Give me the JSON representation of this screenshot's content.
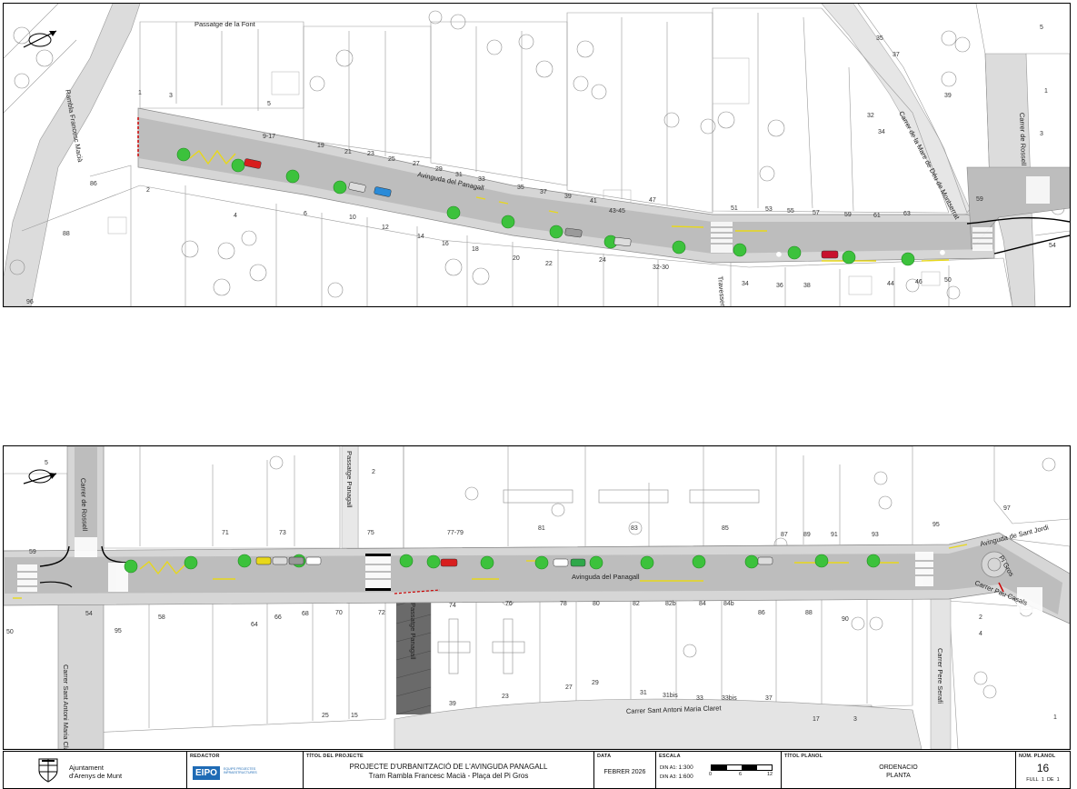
{
  "top_plan": {
    "streets": {
      "passatge_font": "Passatge de la Font",
      "rambla": "Rambla Francesc Macià",
      "avinguda": "Avinguda del Panagall",
      "montserrat": "Carrer de la Mare de Déu de Montserrat",
      "rossell": "Carrer de Rossell",
      "travessera": "Travessera"
    },
    "numbers_north": [
      "1",
      "3",
      "5",
      "9-17",
      "19",
      "21",
      "23",
      "25",
      "27",
      "29",
      "31",
      "33",
      "35",
      "37",
      "39",
      "41",
      "43-45",
      "47",
      "51",
      "53",
      "55",
      "57",
      "59",
      "61",
      "63",
      "59"
    ],
    "numbers_south": [
      "2",
      "4",
      "6",
      "10",
      "12",
      "14",
      "16",
      "18",
      "20",
      "22",
      "24",
      "32-30",
      "34",
      "36",
      "38",
      "44",
      "46",
      "50",
      "54"
    ],
    "numbers_misc": [
      "35",
      "37",
      "39",
      "32",
      "34",
      "3",
      "1",
      "5",
      "86",
      "88",
      "96"
    ]
  },
  "bottom_plan": {
    "streets": {
      "rossell": "Carrer de Rossell",
      "passatge": "Passatge Panagall",
      "avinguda": "Avinguda del Panagall",
      "sant_jordi": "Avinguda de Sant Jordi",
      "pi_gros": "Pi Gros",
      "pau_casals": "Carrer Pau Casals",
      "sant_antoni_vert": "Carrer Sant Antoni Maria Claret",
      "sant_antoni": "Carrer Sant Antoni Maria Claret",
      "pere_serafi": "Carrer Pere Serafí",
      "passatge_vert": "Passatge Panagall"
    },
    "numbers_north": [
      "59",
      "71",
      "73",
      "75",
      "77-79",
      "81",
      "83",
      "85",
      "87",
      "89",
      "91",
      "93",
      "95",
      "97",
      "2"
    ],
    "numbers_south": [
      "50",
      "54",
      "58",
      "64",
      "66",
      "68",
      "70",
      "72",
      "74",
      "76",
      "78",
      "80",
      "82",
      "82b",
      "84",
      "84b",
      "86",
      "88",
      "90",
      "95",
      "2",
      "4"
    ],
    "numbers_misc": [
      "5",
      "27",
      "29",
      "31",
      "31bis",
      "33",
      "33bis",
      "37",
      "39",
      "23",
      "25",
      "15",
      "17",
      "3",
      "1"
    ]
  },
  "title_block": {
    "org_line1": "Ajuntament",
    "org_line2": "d'Arenys de Munt",
    "redactor_head": "REDACTOR",
    "redactor_logo": "EIPO",
    "redactor_small": "EQUIPS PROJECTES INFRAESTRUCTURES",
    "project_head": "TÍTOL DEL PROJECTE",
    "project_line1": "PROJECTE D'URBANITZACIÓ DE L'AVINGUDA PANAGALL",
    "project_line2": "Tram Rambla Francesc Macià - Plaça del Pi Gros",
    "date_head": "DATA",
    "date_value": "FEBRER 2026",
    "scale_head": "ESCALA",
    "scale_a1_label": "DIN A1:",
    "scale_a1_value": "1:300",
    "scale_a3_label": "DIN A3:",
    "scale_a3_value": "1:600",
    "scale_ticks": [
      "0",
      "6",
      "12"
    ],
    "plan_title_head": "TÍTOL PLÀNOL",
    "plan_title_line1": "ORDENACIO",
    "plan_title_line2": "PLANTA",
    "plan_num_head": "NÚM. PLÀNOL",
    "plan_num": "16",
    "sheet_label": "FULL",
    "sheet_num": "1",
    "sheet_of": "DE",
    "sheet_total": "1"
  },
  "colors": {
    "road": "#bdbdbd",
    "pavement": "#d8d8d8",
    "tree": "#3cc23c",
    "bikelane": "#e8d81a"
  }
}
